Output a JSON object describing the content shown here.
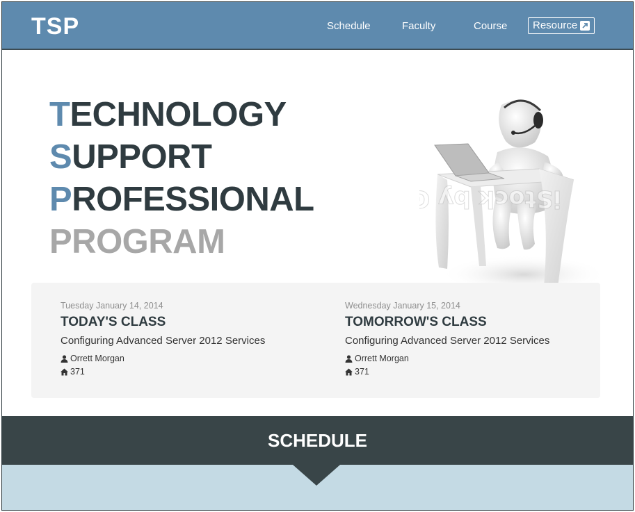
{
  "navbar": {
    "brand": "TSP",
    "links": [
      "Schedule",
      "Faculty",
      "Course"
    ],
    "resource_label": "Resource",
    "color": "#5e8aae"
  },
  "hero": {
    "lines": [
      {
        "first": "T",
        "rest": "ECHNOLOGY"
      },
      {
        "first": "S",
        "rest": "UPPORT"
      },
      {
        "first": "P",
        "rest": "ROFESSIONAL"
      }
    ],
    "last_line": "PROGRAM",
    "watermark": "iStock by Getty Images"
  },
  "classes": {
    "today": {
      "date": "Tuesday January 14, 2014",
      "heading": "TODAY'S CLASS",
      "course": "Configuring Advanced Server 2012 Services",
      "instructor": "Orrett Morgan",
      "room": "371"
    },
    "tomorrow": {
      "date": "Wednesday January 15, 2014",
      "heading": "TOMORROW'S CLASS",
      "course": "Configuring Advanced Server 2012 Services",
      "instructor": "Orrett Morgan",
      "room": "371"
    }
  },
  "schedule": {
    "title": "SCHEDULE"
  },
  "icons": {
    "instructor": "user-icon",
    "room": "home-icon",
    "resource": "external-link-icon"
  }
}
